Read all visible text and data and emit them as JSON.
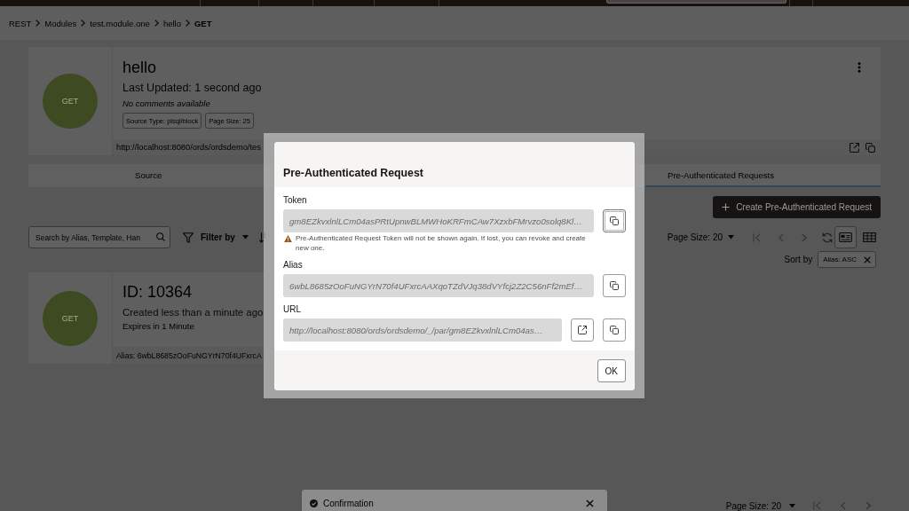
{
  "breadcrumbs": [
    {
      "label": "REST",
      "current": false
    },
    {
      "label": "Modules",
      "current": false
    },
    {
      "label": "test.module.one",
      "current": false
    },
    {
      "label": "hello",
      "current": false
    },
    {
      "label": "GET",
      "current": true
    }
  ],
  "handler": {
    "method": "GET",
    "title": "hello",
    "updated": "Last Updated: 1 second ago",
    "comments": "No comments available",
    "chips": [
      "Source Type: plsql/block",
      "Page Size: 25"
    ],
    "url": "http://localhost:8080/ords/ordsdemo/tes"
  },
  "tabs": [
    {
      "label": "Source",
      "selected": false
    },
    {
      "label": "Pre-Authenticated Requests",
      "selected": true
    }
  ],
  "create_button": {
    "label": "Create Pre-Authenticated Request"
  },
  "toolbar": {
    "search": {
      "placeholder": "Search by Alias, Template, Han"
    },
    "filter": {
      "label": "Filter by"
    },
    "page_size": "Page Size: 20",
    "pager": [
      {
        "kind": "first",
        "disabled": true
      },
      {
        "kind": "previous",
        "disabled": true
      },
      {
        "kind": "next",
        "disabled": true
      },
      {
        "kind": "refresh",
        "disabled": false
      }
    ],
    "views": [
      {
        "kind": "card",
        "selected": true
      },
      {
        "kind": "table",
        "selected": false
      }
    ]
  },
  "sort": {
    "label": "Sort by",
    "chips": [
      {
        "label": "Alias: ASC"
      }
    ]
  },
  "requests": [
    {
      "method": "GET",
      "id": "ID: 10364",
      "created": "Created less than a minute ago",
      "expires": "Expires in 1 Minute",
      "alias": "Alias: 6wbL8685zOoFuNGYrN70f4UFxrcA"
    }
  ],
  "bottom_pager": {
    "page_size": "Page Size: 20",
    "controls": [
      {
        "kind": "first",
        "disabled": true
      },
      {
        "kind": "previous",
        "disabled": true
      },
      {
        "kind": "next",
        "disabled": true
      }
    ]
  },
  "toast": {
    "title": "Confirmation"
  },
  "dialog": {
    "title": "Pre-Authenticated Request",
    "fields": [
      {
        "label": "Token",
        "value": "gm8EZkvxlnlLCm04asPRtUpnwBLMWHoKRFmCAw7XzxbFMrvzo0solq8Kl…",
        "warning": "Pre-Authenticated Request Token will not be shown again. If lost, you can revoke and create new one.",
        "actions": [
          {
            "kind": "copy",
            "focused": true
          }
        ]
      },
      {
        "label": "Alias",
        "value": "6wbL8685zOoFuNGYrN70f4UFxrcAAXqoTZdVJq38dVYfcj2Z2C56nFf2mEf…",
        "actions": [
          {
            "kind": "copy",
            "focused": false
          }
        ]
      },
      {
        "label": "URL",
        "value": "http://localhost:8080/ords/ordsdemo/_/par/gm8EZkvxlnlLCm04as…",
        "actions": [
          {
            "kind": "open",
            "focused": false
          },
          {
            "kind": "copy",
            "focused": false
          }
        ]
      }
    ],
    "buttons": [
      {
        "label": "OK"
      }
    ]
  }
}
